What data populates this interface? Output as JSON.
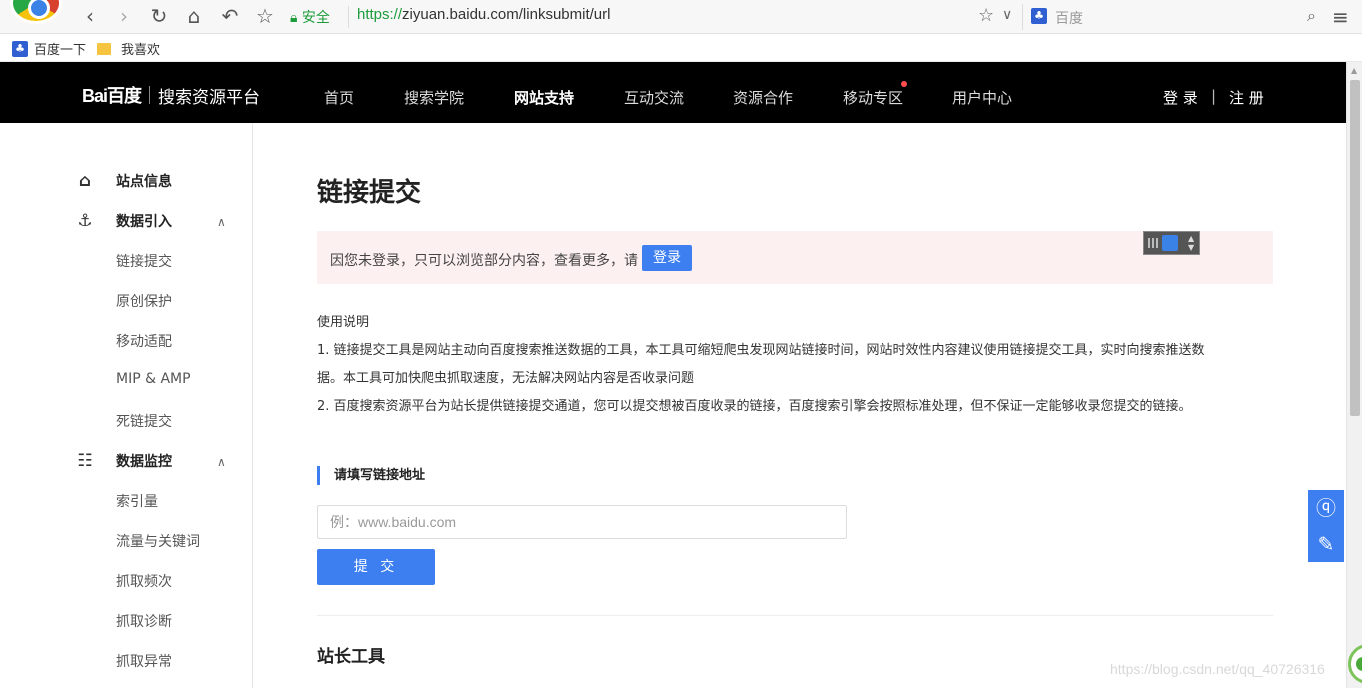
{
  "browser": {
    "secure_label": "安全",
    "url_proto": "https://",
    "url_rest": "ziyuan.baidu.com/linksubmit/url",
    "search_placeholder": "百度",
    "bookmarks": [
      {
        "label": "百度一下"
      },
      {
        "label": "我喜欢"
      }
    ]
  },
  "header": {
    "logo": "Bai百度",
    "platform": "搜索资源平台",
    "nav": [
      {
        "label": "首页"
      },
      {
        "label": "搜索学院"
      },
      {
        "label": "网站支持"
      },
      {
        "label": "互动交流"
      },
      {
        "label": "资源合作"
      },
      {
        "label": "移动专区"
      },
      {
        "label": "用户中心"
      }
    ],
    "login": "登 录",
    "divider": "|",
    "register": "注 册"
  },
  "sidebar": {
    "groups": [
      {
        "label": "站点信息",
        "icon": "home-icon"
      },
      {
        "label": "数据引入",
        "icon": "data-import-icon"
      },
      {
        "label": "数据监控",
        "icon": "monitor-chart-icon"
      }
    ],
    "items": [
      {
        "label": "链接提交"
      },
      {
        "label": "原创保护"
      },
      {
        "label": "移动适配"
      },
      {
        "label": "MIP & AMP"
      },
      {
        "label": "死链提交"
      },
      {
        "label": "索引量"
      },
      {
        "label": "流量与关键词"
      },
      {
        "label": "抓取频次"
      },
      {
        "label": "抓取诊断"
      },
      {
        "label": "抓取异常"
      }
    ]
  },
  "main": {
    "title": "链接提交",
    "notice": "因您未登录，只可以浏览部分内容，查看更多，请",
    "notice_login": "登录",
    "usage_title": "使用说明",
    "usage_lines": [
      "1. 链接提交工具是网站主动向百度搜索推送数据的工具，本工具可缩短爬虫发现网站链接时间，网站时效性内容建议使用链接提交工具，实时向搜索推送数",
      "据。本工具可加快爬虫抓取速度，无法解决网站内容是否收录问题",
      "2. 百度搜索资源平台为站长提供链接提交通道，您可以提交想被百度收录的链接，百度搜索引擎会按照标准处理，但不保证一定能够收录您提交的链接。"
    ],
    "section_label": "请填写链接地址",
    "input_placeholder": "例：www.baidu.com",
    "submit_label": "提 交",
    "tools_title": "站长工具"
  },
  "watermark": "https://blog.csdn.net/qq_40726316",
  "colors": {
    "accent": "#3d7ff0",
    "header_bg": "#000000",
    "notice_bg": "#fdf0f0"
  }
}
